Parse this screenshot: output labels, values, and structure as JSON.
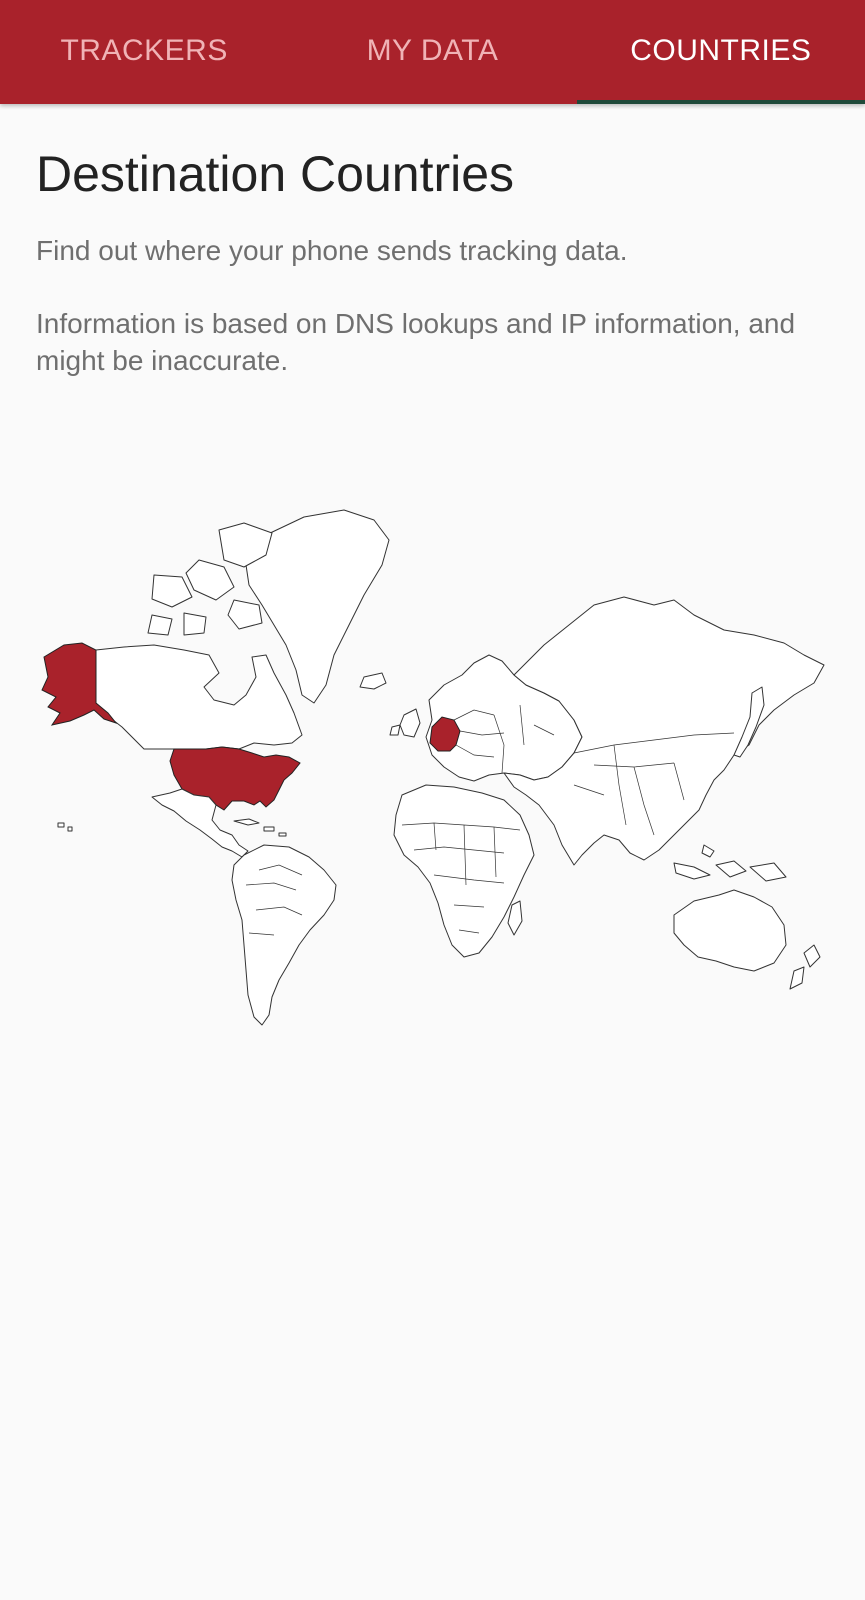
{
  "tabs": [
    {
      "label": "TRACKERS",
      "active": false
    },
    {
      "label": "MY DATA",
      "active": false
    },
    {
      "label": "COUNTRIES",
      "active": true
    }
  ],
  "colors": {
    "app_bar": "#a9222b",
    "tab_indicator": "#1f4a3a",
    "highlighted_country": "#a9222b",
    "background": "#fafafa"
  },
  "page": {
    "title": "Destination Countries",
    "description_1": "Find out where your phone sends tracking data.",
    "description_2": "Information is based on DNS lookups and IP information, and might be inaccurate."
  },
  "map": {
    "highlighted_countries": [
      "United States",
      "Germany"
    ]
  }
}
